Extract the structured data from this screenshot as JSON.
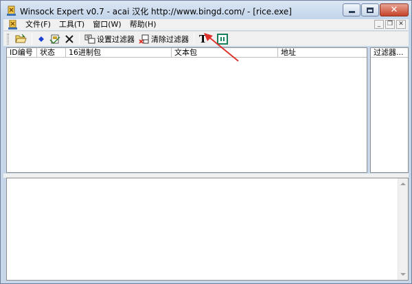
{
  "window": {
    "title": "Winsock Expert v0.7 - acai 汉化 http://www.bingd.com/ - [rice.exe]",
    "icon": "app-icon"
  },
  "menubar": {
    "items": [
      {
        "label": "文件(F)"
      },
      {
        "label": "工具(T)"
      },
      {
        "label": "窗口(W)"
      },
      {
        "label": "帮助(H)"
      }
    ]
  },
  "toolbar": {
    "set_filter_label": "设置过滤器",
    "clear_filter_label": "清除过滤器",
    "text_button_label": "T"
  },
  "packet_list": {
    "columns": [
      {
        "label": "ID编号"
      },
      {
        "label": "状态"
      },
      {
        "label": "16进制包"
      },
      {
        "label": "文本包"
      },
      {
        "label": "地址"
      }
    ],
    "rows": []
  },
  "filter_panel": {
    "header": "过滤器..."
  },
  "colors": {
    "frame": "#c7d7ea",
    "annotation_arrow": "#e0302a",
    "pause_accent": "#13805a"
  }
}
